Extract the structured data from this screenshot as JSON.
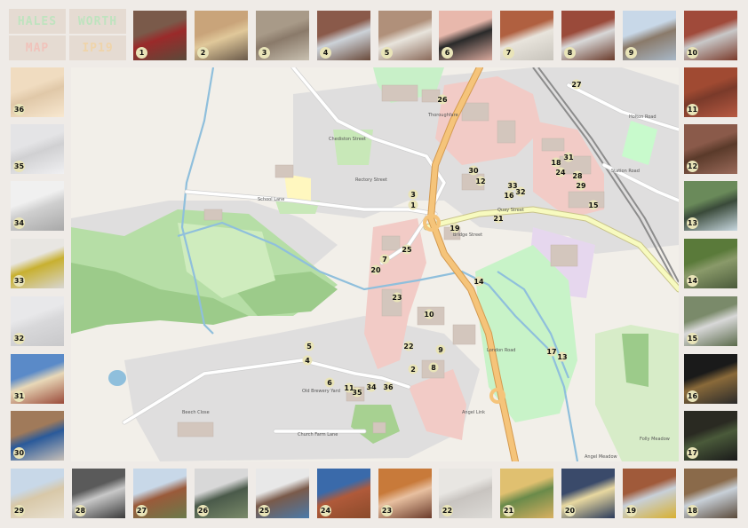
{
  "title": {
    "words": [
      {
        "text": "HALES",
        "color": "#cfe9cf",
        "bg": "#e4d9cf",
        "fg": "#bfe4bf"
      },
      {
        "text": "WORTH",
        "color": "#c7ebc7",
        "bg": "#e7dccf",
        "fg": "#b9e4b9"
      },
      {
        "text": "MAP",
        "color": "#f2c6c0",
        "bg": "#e6dbcf",
        "fg": "#f0c3bb"
      },
      {
        "text": "IP19",
        "color": "#f0d6b0",
        "bg": "#e6dbcf",
        "fg": "#efd4aa"
      }
    ]
  },
  "photos": [
    {
      "n": "1",
      "desc": "red door and railing",
      "colors": [
        "#7a5a4a",
        "#9a2a2a",
        "#5a4a3a"
      ]
    },
    {
      "n": "2",
      "desc": "boarded shop front",
      "colors": [
        "#c9a47a",
        "#e0c89a",
        "#6a5a4a"
      ]
    },
    {
      "n": "3",
      "desc": "brick outbuilding",
      "colors": [
        "#a89a88",
        "#8a7a6a",
        "#c8c0b0"
      ]
    },
    {
      "n": "4",
      "desc": "window in brick wall",
      "colors": [
        "#8a5a4a",
        "#ccd2d8",
        "#6a4a3a"
      ]
    },
    {
      "n": "5",
      "desc": "white sash window",
      "colors": [
        "#b0907a",
        "#e8e4dc",
        "#8a6a5a"
      ]
    },
    {
      "n": "6",
      "desc": "pink house window",
      "colors": [
        "#e8b8ac",
        "#2a2a2a",
        "#d8a89c"
      ]
    },
    {
      "n": "7",
      "desc": "white cottage roof",
      "colors": [
        "#b06040",
        "#e8e4dc",
        "#c8c4bc"
      ]
    },
    {
      "n": "8",
      "desc": "old window",
      "colors": [
        "#9a4a3a",
        "#d8d8d8",
        "#6a3a2a"
      ]
    },
    {
      "n": "9",
      "desc": "telegraph pole",
      "colors": [
        "#c8d8e8",
        "#8a7a6a",
        "#a8b8c8"
      ]
    },
    {
      "n": "10",
      "desc": "wall with air units",
      "colors": [
        "#a04a3a",
        "#c8c8c8",
        "#7a3a2a"
      ]
    },
    {
      "n": "11",
      "desc": "brick wall",
      "colors": [
        "#a04a32",
        "#7a3a2a",
        "#b85a42"
      ]
    },
    {
      "n": "12",
      "desc": "brick detail",
      "colors": [
        "#8a5a4a",
        "#5a3a2a",
        "#9a6a5a"
      ]
    },
    {
      "n": "13",
      "desc": "structure in trees",
      "colors": [
        "#6a8a5a",
        "#3a4a3a",
        "#c8d8e0"
      ]
    },
    {
      "n": "14",
      "desc": "tangled branches",
      "colors": [
        "#5a7a3a",
        "#8a9a6a",
        "#4a5a3a"
      ]
    },
    {
      "n": "15",
      "desc": "covered shed",
      "colors": [
        "#7a8a6a",
        "#d8d8d8",
        "#5a6a4a"
      ]
    },
    {
      "n": "16",
      "desc": "grass at night",
      "colors": [
        "#1a1a1a",
        "#8a6a3a",
        "#2a2a2a"
      ]
    },
    {
      "n": "17",
      "desc": "dark vegetation",
      "colors": [
        "#2a2a22",
        "#4a5a3a",
        "#1a1a1a"
      ]
    },
    {
      "n": "18",
      "desc": "barn building",
      "colors": [
        "#8a6a4a",
        "#c8d0d8",
        "#5a4a3a"
      ]
    },
    {
      "n": "19",
      "desc": "brick building yellow bin",
      "colors": [
        "#a05a3a",
        "#c8d0d8",
        "#d8b030"
      ]
    },
    {
      "n": "20",
      "desc": "lit window at dusk",
      "colors": [
        "#3a4a6a",
        "#e8d8a0",
        "#2a3a5a"
      ]
    },
    {
      "n": "21",
      "desc": "yellow house",
      "colors": [
        "#e0c070",
        "#6a8a4a",
        "#d8b060"
      ]
    },
    {
      "n": "22",
      "desc": "white wall",
      "colors": [
        "#e8e6e2",
        "#c8c4c0",
        "#dcdad6"
      ]
    },
    {
      "n": "23",
      "desc": "orange lit doorway",
      "colors": [
        "#c87a3a",
        "#e8c0a0",
        "#6a3a2a"
      ]
    },
    {
      "n": "24",
      "desc": "tall brick building",
      "colors": [
        "#3a6aaa",
        "#b05a3a",
        "#8a4a2a"
      ]
    },
    {
      "n": "25",
      "desc": "house gable",
      "colors": [
        "#e8e8e8",
        "#7a5a4a",
        "#4a7aaa"
      ]
    },
    {
      "n": "26",
      "desc": "chimney",
      "colors": [
        "#d8d8d8",
        "#4a5a4a",
        "#7a8a6a"
      ]
    },
    {
      "n": "27",
      "desc": "brick house with trees",
      "colors": [
        "#c8d8e8",
        "#9a5a3a",
        "#6a7a4a"
      ]
    },
    {
      "n": "28",
      "desc": "garage door",
      "colors": [
        "#5a5a5a",
        "#c8c8c8",
        "#3a3a3a"
      ]
    },
    {
      "n": "29",
      "desc": "flat roofed building",
      "colors": [
        "#c8d8e8",
        "#d8c8a8",
        "#e8e0d0"
      ]
    },
    {
      "n": "30",
      "desc": "blue bins",
      "colors": [
        "#a07a5a",
        "#2a5a9a",
        "#c8c0b8"
      ]
    },
    {
      "n": "31",
      "desc": "window in wall",
      "colors": [
        "#5a8ac8",
        "#e8d8b8",
        "#9a4a3a"
      ]
    },
    {
      "n": "32",
      "desc": "white render",
      "colors": [
        "#e8e8ea",
        "#d8d8da",
        "#c8c8ca"
      ]
    },
    {
      "n": "33",
      "desc": "yellow flower spike",
      "colors": [
        "#e8e6e2",
        "#c8b030",
        "#d8d6d2"
      ]
    },
    {
      "n": "34",
      "desc": "white block wall",
      "colors": [
        "#f0f0f0",
        "#cfcfcf",
        "#a8a8a8"
      ]
    },
    {
      "n": "35",
      "desc": "textured wall",
      "colors": [
        "#e4e4e6",
        "#d0d0d2",
        "#f0f0f2"
      ]
    },
    {
      "n": "36",
      "desc": "cream wall corner",
      "colors": [
        "#f0dcc0",
        "#e0c8a8",
        "#f8e8d0"
      ]
    }
  ],
  "map": {
    "road_labels": [
      "Bridge Street",
      "School Lane",
      "Quay Street",
      "Old Brewery Yard",
      "Church Farm Lane",
      "Beech Close",
      "Angel Link",
      "Angel Meadow",
      "Folly Meadow",
      "Station Road",
      "Rectory Street",
      "Chediston Street",
      "Holton Road",
      "London Road",
      "Thoroughfare"
    ],
    "points": [
      {
        "n": "1"
      },
      {
        "n": "2"
      },
      {
        "n": "3"
      },
      {
        "n": "4"
      },
      {
        "n": "5"
      },
      {
        "n": "6"
      },
      {
        "n": "7"
      },
      {
        "n": "8"
      },
      {
        "n": "9"
      },
      {
        "n": "10"
      },
      {
        "n": "11"
      },
      {
        "n": "12"
      },
      {
        "n": "13"
      },
      {
        "n": "14"
      },
      {
        "n": "15"
      },
      {
        "n": "16"
      },
      {
        "n": "17"
      },
      {
        "n": "18"
      },
      {
        "n": "19"
      },
      {
        "n": "20"
      },
      {
        "n": "21"
      },
      {
        "n": "22"
      },
      {
        "n": "23"
      },
      {
        "n": "24"
      },
      {
        "n": "25"
      },
      {
        "n": "26"
      },
      {
        "n": "27"
      },
      {
        "n": "28"
      },
      {
        "n": "29"
      },
      {
        "n": "30"
      },
      {
        "n": "31"
      },
      {
        "n": "32"
      },
      {
        "n": "33"
      },
      {
        "n": "34"
      },
      {
        "n": "35"
      },
      {
        "n": "36"
      }
    ]
  },
  "colors": {
    "background": "#efebe7",
    "land": "#f2efe9",
    "residential": "#e0dfdf",
    "commercial": "#f2cbc6",
    "park": "#c8facc",
    "meadow": "#b4d9a6",
    "wood": "#9cc88a",
    "water": "#aad3df",
    "main_road": "#f5c47a",
    "secondary_road": "#f7fabf",
    "building": "#d9d0c9",
    "label_badge": "#e9e4b8"
  }
}
